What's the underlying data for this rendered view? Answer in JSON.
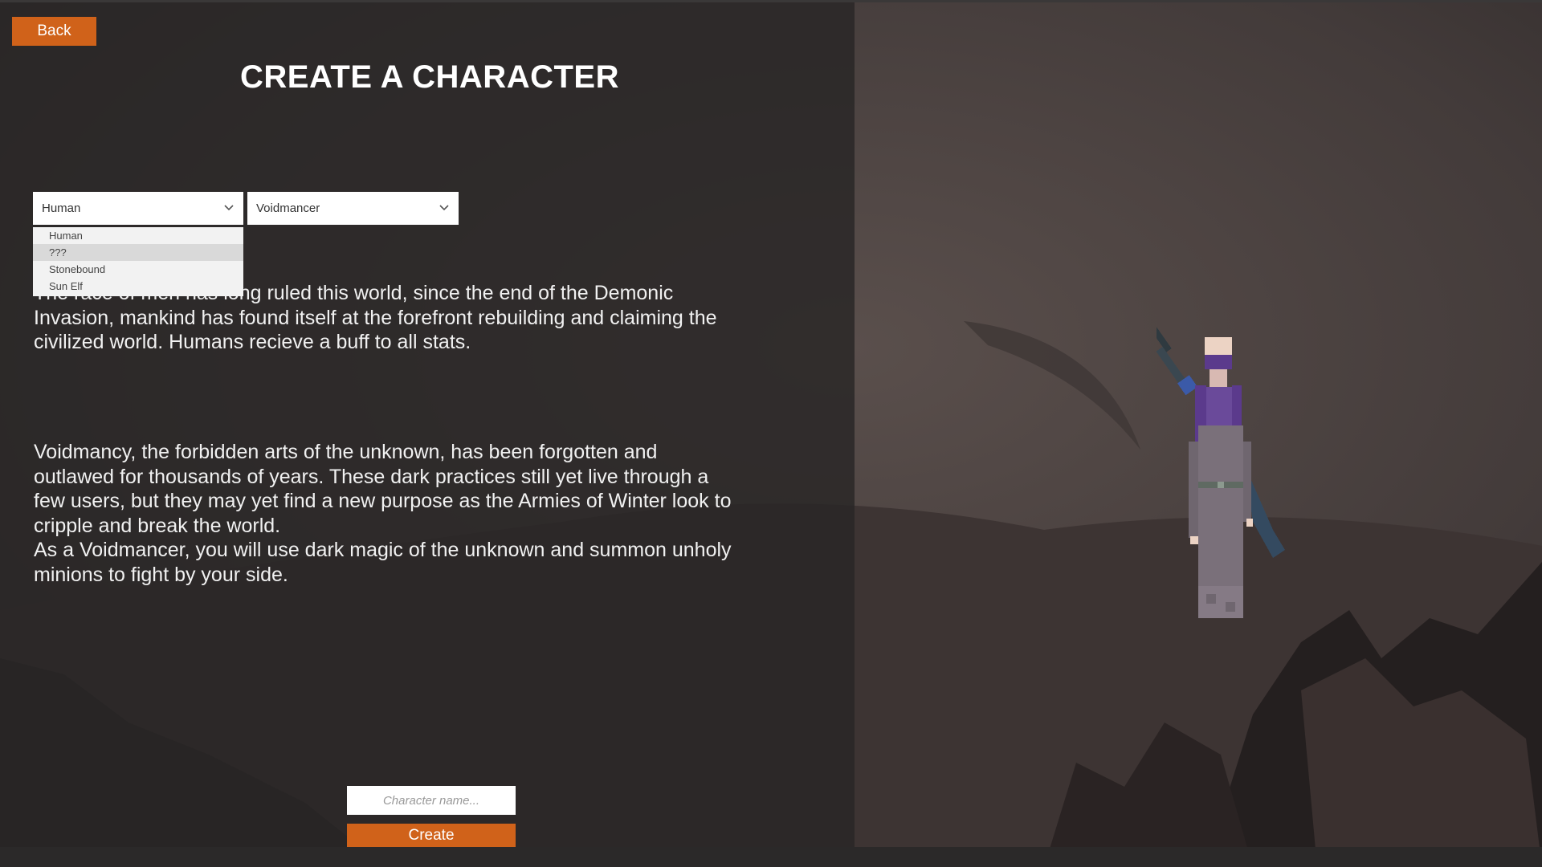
{
  "nav": {
    "back_label": "Back"
  },
  "page": {
    "title": "CREATE A CHARACTER"
  },
  "race_dropdown": {
    "selected": "Human",
    "options": [
      "Human",
      "???",
      "Stonebound",
      "Sun Elf"
    ],
    "highlighted_index": 1
  },
  "class_dropdown": {
    "selected": "Voidmancer"
  },
  "race_description": "The race of men has long ruled this world, since the end of the Demonic Invasion, mankind has found itself at the forefront rebuilding and claiming the civilized world. Humans recieve a buff to all stats.",
  "class_description_1": "Voidmancy, the forbidden arts of the unknown, has been forgotten and outlawed for thousands of years. These dark practices still yet live through a few users, but they may yet find a new purpose as the Armies of Winter look to cripple and break the world.",
  "class_description_2": "As a Voidmancer, you will use dark magic of the unknown and summon unholy minions to fight by your side.",
  "name_input": {
    "placeholder": "Character name...",
    "value": ""
  },
  "create_label": "Create",
  "colors": {
    "accent": "#d0621a",
    "panel": "#2e2c2c",
    "character_hair": "#5b3a8c",
    "character_robe": "#7a707a"
  },
  "icons": {
    "dropdown": "chevron-down-icon"
  }
}
